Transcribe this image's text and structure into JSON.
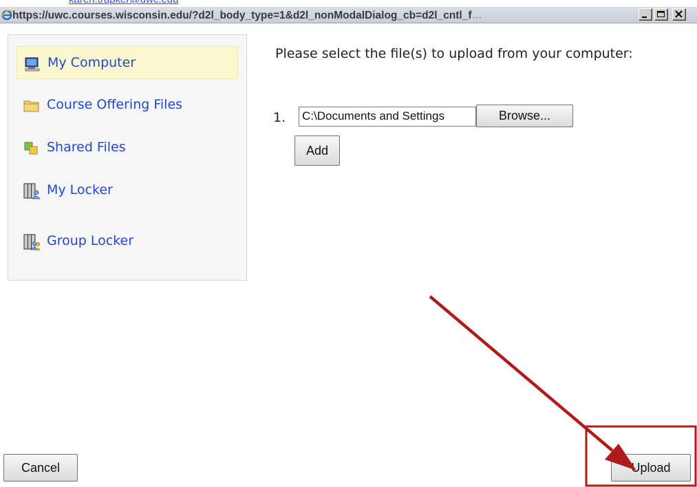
{
  "window": {
    "title": "https://uwc.courses.wisconsin.edu/?d2l_body_type=1&d2l_nonModalDialog_cb=d2l_cntl_f",
    "title_faded_tail": "…"
  },
  "behind_text": "karen.trapker@uwc.edu",
  "sidebar": {
    "items": [
      {
        "label": "My Computer",
        "icon": "computer-icon",
        "active": true
      },
      {
        "label": "Course Offering Files",
        "icon": "folder-icon"
      },
      {
        "label": "Shared Files",
        "icon": "shared-files-icon"
      },
      {
        "label": "My Locker",
        "icon": "locker-icon"
      },
      {
        "label": "Group Locker",
        "icon": "group-locker-icon"
      }
    ]
  },
  "main": {
    "prompt": "Please select the file(s) to upload from your computer:",
    "file_rows": [
      {
        "number": "1.",
        "value": "C:\\Documents and Settings"
      }
    ],
    "browse_label": "Browse...",
    "add_label": "Add"
  },
  "footer": {
    "cancel_label": "Cancel",
    "upload_label": "Upload"
  },
  "annotation": {
    "color": "#b01a1a"
  }
}
